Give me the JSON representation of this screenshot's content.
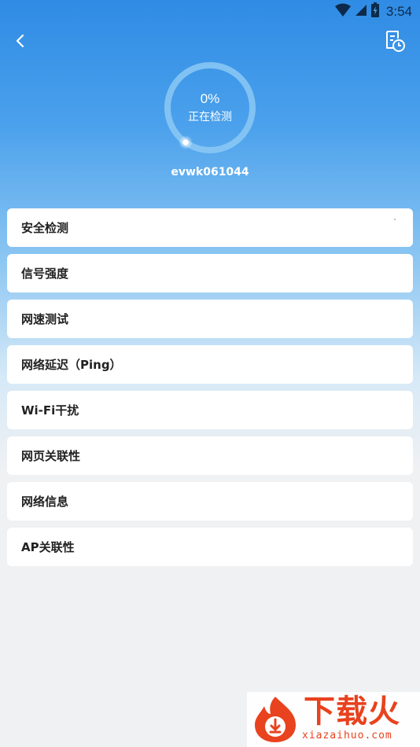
{
  "status_bar": {
    "time": "3:54",
    "icons": [
      "wifi-icon",
      "cell-signal-icon",
      "battery-icon"
    ]
  },
  "header": {
    "back_icon": "chevron-left-icon",
    "history_icon": "document-clock-icon"
  },
  "progress": {
    "percent_text": "0%",
    "status_text": "正在检测",
    "value": 0
  },
  "network": {
    "ssid": "evwk061044"
  },
  "items": [
    {
      "label": "安全检测",
      "indicator": "`"
    },
    {
      "label": "信号强度"
    },
    {
      "label": "网速测试"
    },
    {
      "label": "网络延迟（Ping）"
    },
    {
      "label": "Wi-Fi干扰"
    },
    {
      "label": "网页关联性"
    },
    {
      "label": "网络信息"
    },
    {
      "label": "AP关联性"
    }
  ],
  "watermark": {
    "title": "下载火",
    "url": "xiazaihuo.com"
  },
  "colors": {
    "header_top": "#2f8be4",
    "background": "#f0f1f3",
    "card": "#ffffff",
    "watermark": "#e8421e"
  }
}
